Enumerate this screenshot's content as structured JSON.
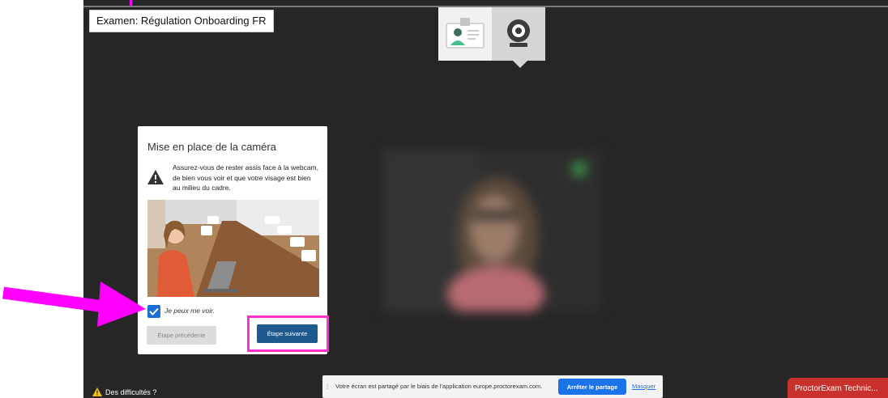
{
  "header": {
    "exam_title": "Examen: Régulation Onboarding FR"
  },
  "steps": [
    {
      "name": "id-card-icon",
      "state": "done"
    },
    {
      "name": "webcam-icon",
      "state": "active"
    }
  ],
  "modal": {
    "title": "Mise en place de la caméra",
    "instructions": "Assurez-vous de rester assis face à la webcam, de bien vous voir et que votre visage est bien au milieu du cadre.",
    "checkbox_label": "Je peux me voir.",
    "checkbox_checked": true,
    "prev_button": "Étape précédente",
    "next_button": "Étape suivante"
  },
  "footer": {
    "difficulties_label": "Des difficultés ?"
  },
  "share_bar": {
    "message": "Votre écran est partagé par le biais de l'application europe.proctorexam.com.",
    "stop_button": "Arrêter le partage",
    "hide_link": "Masquer"
  },
  "chat_tab": {
    "label": "ProctorExam Technic..."
  },
  "colors": {
    "background": "#262626",
    "accent_blue": "#1e5a8f",
    "annotation_magenta": "#ff00ff",
    "chat_red": "#c8312c"
  }
}
